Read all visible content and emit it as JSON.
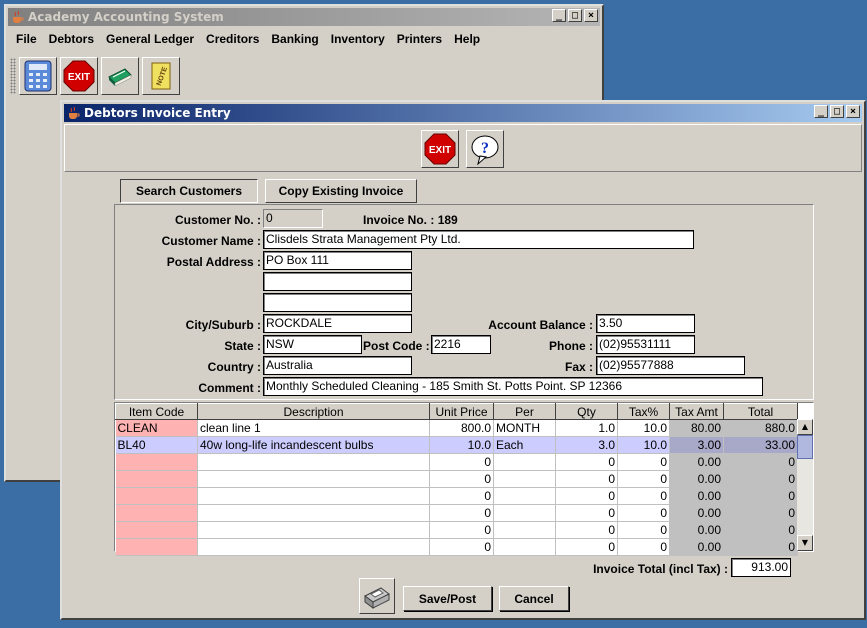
{
  "bg_window": {
    "title": "Academy Accounting System",
    "menu": [
      "File",
      "Debtors",
      "General Ledger",
      "Creditors",
      "Banking",
      "Inventory",
      "Printers",
      "Help"
    ],
    "toolbar_icons": [
      "calculator-icon",
      "exit-icon",
      "book-icon",
      "notes-icon"
    ],
    "exit_label": "EXIT",
    "notes_label": "NOTE"
  },
  "dialog": {
    "title": "Debtors Invoice Entry",
    "exit_label": "EXIT",
    "help_label": "?",
    "search_customers": "Search Customers",
    "copy_existing_invoice": "Copy Existing Invoice"
  },
  "form": {
    "customer_no_label": "Customer No. :",
    "customer_no": "0",
    "invoice_no_label": "Invoice No. :",
    "invoice_no": "189",
    "customer_name_label": "Customer Name :",
    "customer_name": "Clisdels Strata Management Pty Ltd.",
    "postal_address_label": "Postal Address :",
    "postal_address_1": "PO Box 111",
    "postal_address_2": "",
    "postal_address_3": "",
    "city_label": "City/Suburb :",
    "city": "ROCKDALE",
    "account_balance_label": "Account Balance :",
    "account_balance": "3.50",
    "state_label": "State :",
    "state": "NSW",
    "post_code_label": "Post Code :",
    "post_code": "2216",
    "phone_label": "Phone :",
    "phone": "(02)95531111",
    "country_label": "Country :",
    "country": "Australia",
    "fax_label": "Fax :",
    "fax": "(02)95577888",
    "comment_label": "Comment :",
    "comment": "Monthly Scheduled Cleaning - 185 Smith St. Potts Point. SP 12366"
  },
  "table": {
    "headers": [
      "Item Code",
      "Description",
      "Unit Price",
      "Per",
      "Qty",
      "Tax%",
      "Tax Amt",
      "Total"
    ],
    "rows": [
      [
        "CLEAN",
        "clean line 1",
        "800.0",
        "MONTH",
        "1.0",
        "10.0",
        "80.00",
        "880.0"
      ],
      [
        "BL40",
        "40w long-life incandescent bulbs",
        "10.0",
        "Each",
        "3.0",
        "10.0",
        "3.00",
        "33.00"
      ],
      [
        "",
        "",
        "0",
        "",
        "0",
        "0",
        "0.00",
        "0"
      ],
      [
        "",
        "",
        "0",
        "",
        "0",
        "0",
        "0.00",
        "0"
      ],
      [
        "",
        "",
        "0",
        "",
        "0",
        "0",
        "0.00",
        "0"
      ],
      [
        "",
        "",
        "0",
        "",
        "0",
        "0",
        "0.00",
        "0"
      ],
      [
        "",
        "",
        "0",
        "",
        "0",
        "0",
        "0.00",
        "0"
      ],
      [
        "",
        "",
        "0",
        "",
        "0",
        "0",
        "0.00",
        "0"
      ]
    ]
  },
  "totals": {
    "invoice_total_label": "Invoice Total (incl Tax) :",
    "invoice_total": "913.00"
  },
  "actions": {
    "save_post": "Save/Post",
    "cancel": "Cancel"
  }
}
